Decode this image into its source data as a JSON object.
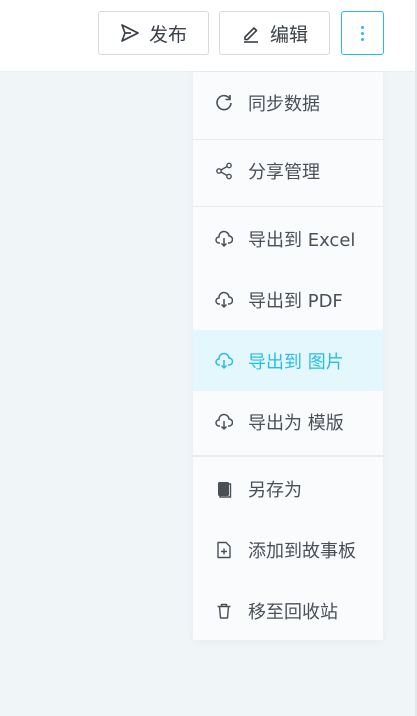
{
  "toolbar": {
    "publish_label": "发布",
    "edit_label": "编辑",
    "more_icon": "vertical-dots-icon",
    "accent_color": "#28bde6"
  },
  "menu": {
    "items": [
      {
        "label": "同步数据",
        "icon": "refresh-icon"
      },
      {
        "label": "分享管理",
        "icon": "share-icon"
      },
      {
        "label": "导出到 Excel",
        "icon": "cloud-download-icon"
      },
      {
        "label": "导出到 PDF",
        "icon": "cloud-download-icon"
      },
      {
        "label": "导出到 图片",
        "icon": "cloud-download-icon",
        "active": true
      },
      {
        "label": "导出为 模版",
        "icon": "cloud-download-icon"
      },
      {
        "label": "另存为",
        "icon": "copy-icon"
      },
      {
        "label": "添加到故事板",
        "icon": "file-add-icon"
      },
      {
        "label": "移至回收站",
        "icon": "trash-icon"
      }
    ]
  }
}
